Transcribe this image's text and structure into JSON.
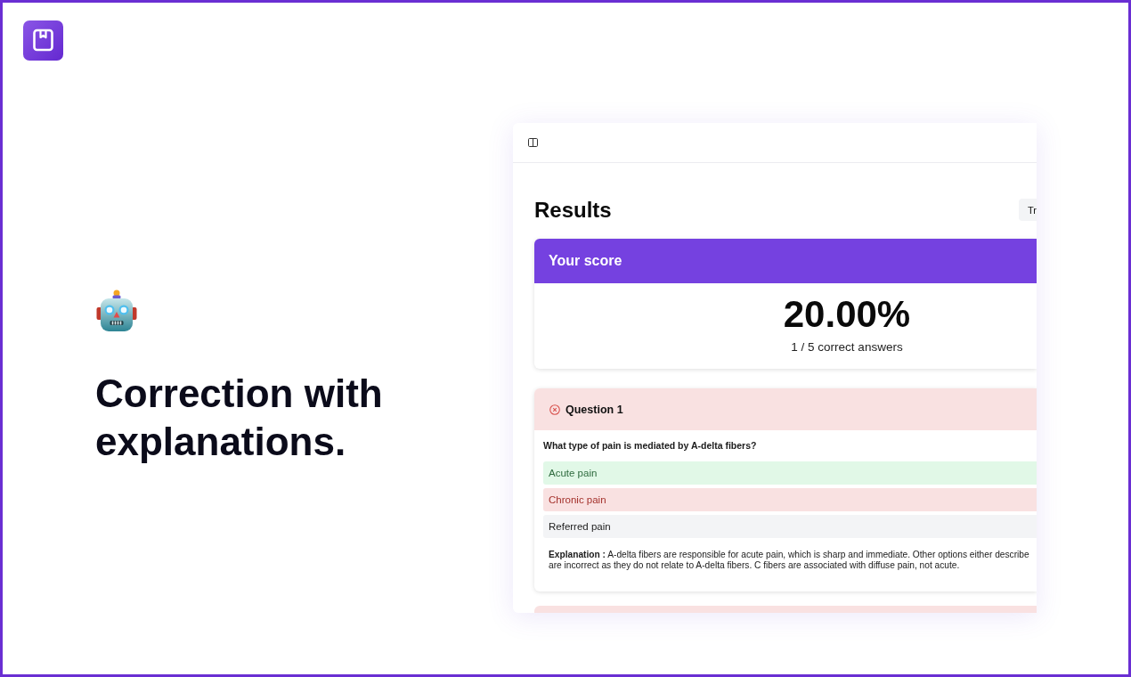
{
  "hero": {
    "heading": "Correction with explanations."
  },
  "app": {
    "title": "Results",
    "action_button": "Tr",
    "score": {
      "header": "Your score",
      "percent": "20.00%",
      "summary": "1 / 5 correct answers"
    },
    "questions": [
      {
        "title": "Question 1",
        "correct": false,
        "prompt": "What type of pain is mediated by A-delta fibers?",
        "options": [
          {
            "label": "Acute pain",
            "correct": true,
            "selected": false
          },
          {
            "label": "Chronic pain",
            "correct": false,
            "selected": true
          },
          {
            "label": "Referred pain",
            "correct": false,
            "selected": false
          }
        ],
        "explanation": "**Explanation :** A-delta fibers are responsible for acute pain, which is sharp and immediate. Other options either describe are incorrect as they do not relate to A-delta fibers. C fibers are associated with diffuse pain, not acute."
      },
      {
        "correct": false
      }
    ]
  }
}
